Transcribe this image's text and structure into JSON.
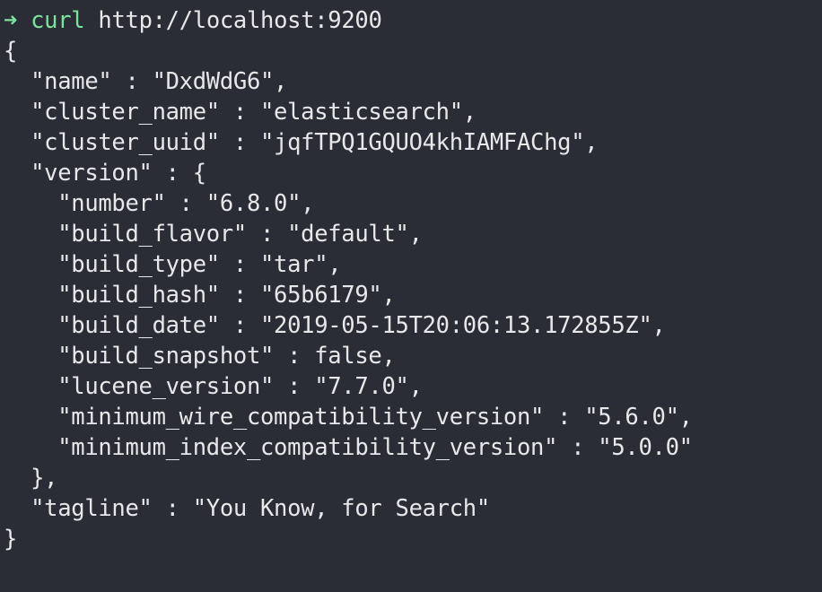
{
  "terminal": {
    "prompt": {
      "arrow_icon": "arrow-right-icon",
      "arrow_glyph": "➜",
      "command": "curl",
      "argument": "http://localhost:9200",
      "prompt_color": "#7be39a"
    },
    "output_lines": [
      "{",
      "  \"name\" : \"DxdWdG6\",",
      "  \"cluster_name\" : \"elasticsearch\",",
      "  \"cluster_uuid\" : \"jqfTPQ1GQUO4khIAMFAChg\",",
      "  \"version\" : {",
      "    \"number\" : \"6.8.0\",",
      "    \"build_flavor\" : \"default\",",
      "    \"build_type\" : \"tar\",",
      "    \"build_hash\" : \"65b6179\",",
      "    \"build_date\" : \"2019-05-15T20:06:13.172855Z\",",
      "    \"build_snapshot\" : false,",
      "    \"lucene_version\" : \"7.7.0\",",
      "    \"minimum_wire_compatibility_version\" : \"5.6.0\",",
      "    \"minimum_index_compatibility_version\" : \"5.0.0\"",
      "  },",
      "  \"tagline\" : \"You Know, for Search\"",
      "}"
    ],
    "background_color": "#2a2d35",
    "text_color": "#e8e8ea"
  }
}
